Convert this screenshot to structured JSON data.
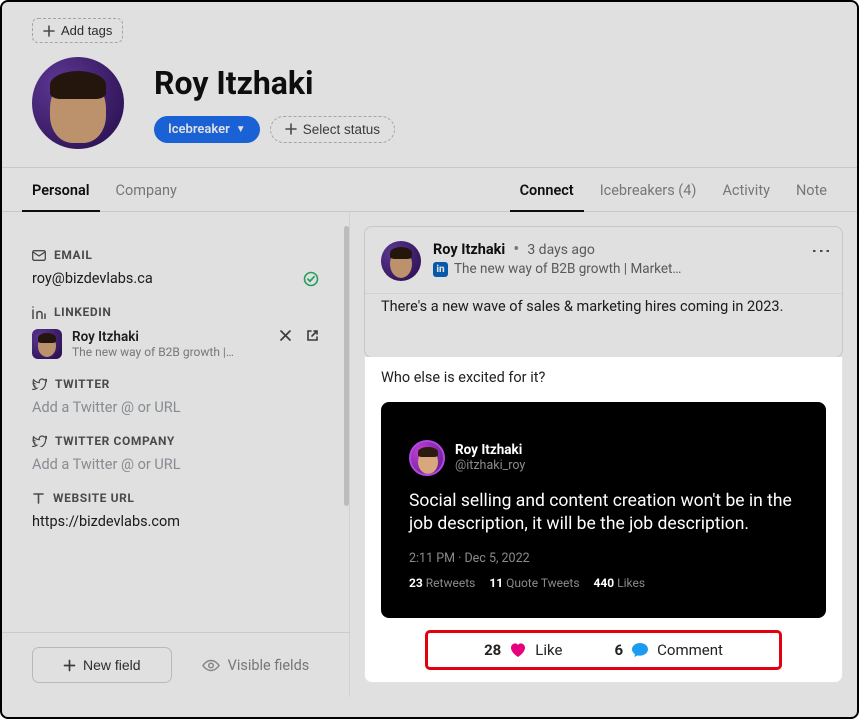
{
  "header": {
    "add_tags": "Add tags",
    "name": "Roy Itzhaki",
    "pill_label": "Icebreaker",
    "select_status": "Select status"
  },
  "tabs_left": {
    "personal": "Personal",
    "company": "Company"
  },
  "tabs_right": {
    "connect": "Connect",
    "icebreakers": "Icebreakers (4)",
    "activity": "Activity",
    "note": "Note"
  },
  "fields": {
    "email_label": "EMAIL",
    "email_value": "roy@bizdevlabs.ca",
    "linkedin_label": "LINKEDIN",
    "linkedin_name": "Roy Itzhaki",
    "linkedin_desc": "The new way of B2B growth |…",
    "twitter_label": "TWITTER",
    "twitter_placeholder": "Add a Twitter @ or URL",
    "twitter_company_label": "TWITTER COMPANY",
    "twitter_company_placeholder": "Add a Twitter @ or URL",
    "website_label": "WEBSITE URL",
    "website_value": "https://bizdevlabs.com"
  },
  "footer": {
    "new_field": "New field",
    "visible_fields": "Visible fields"
  },
  "post": {
    "author": "Roy Itzhaki",
    "time": "3 days ago",
    "subtitle": "The new way of B2B growth | Market…",
    "line1": "There's a new wave of sales & marketing hires coming in 2023.",
    "line2": "Who else is excited for it?",
    "tweet": {
      "name": "Roy Itzhaki",
      "handle": "@itzhaki_roy",
      "text": "Social selling and content creation won't be in the job description, it will be the job description.",
      "meta": "2:11 PM · Dec 5, 2022",
      "retweets_n": "23",
      "retweets_l": "Retweets",
      "quotes_n": "11",
      "quotes_l": "Quote Tweets",
      "likes_n": "440",
      "likes_l": "Likes"
    },
    "actions": {
      "like_count": "28",
      "like_label": "Like",
      "comment_count": "6",
      "comment_label": "Comment"
    }
  }
}
